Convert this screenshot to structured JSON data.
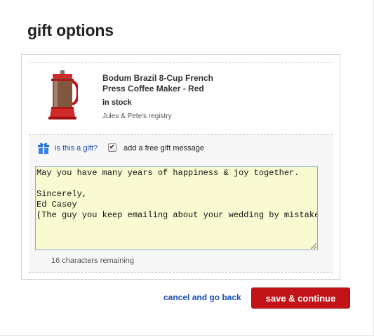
{
  "dialog": {
    "title": "gift options"
  },
  "product": {
    "name": "Bodum Brazil 8-Cup French Press Coffee Maker - Red",
    "stock": "in stock",
    "registry": "Jules & Pete's registry",
    "image_icon": "french-press-icon"
  },
  "gift": {
    "icon": "gift-icon",
    "link_label": "is this a gift?",
    "checkbox_checked": true,
    "checkbox_label": "add a free gift message",
    "message": "May you have many years of happiness & joy together.\n\nSincerely,\nEd Casey\n(The guy you keep emailing about your wedding by mistake)",
    "remaining": "16 characters remaining"
  },
  "actions": {
    "cancel_label": "cancel and go back",
    "save_label": "save & continue"
  },
  "colors": {
    "accent_red": "#c21418",
    "link_blue": "#1a4fb3",
    "textarea_bg": "#fafad2"
  }
}
